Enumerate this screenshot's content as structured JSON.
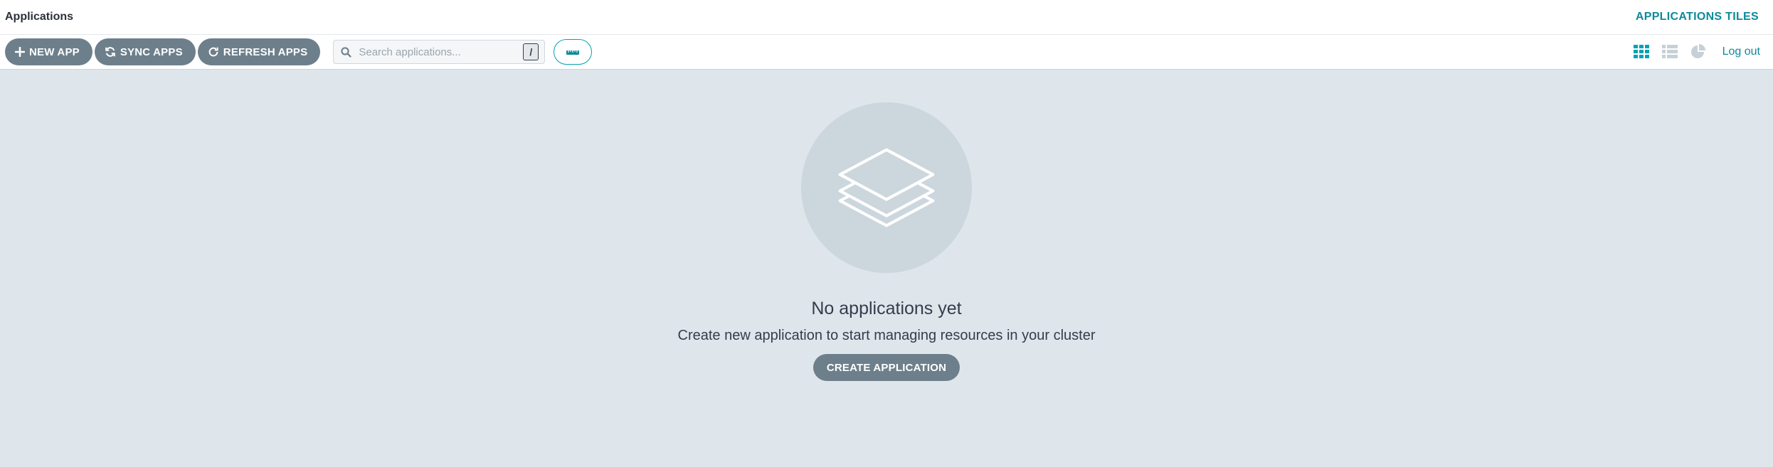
{
  "header": {
    "title": "Applications",
    "view_title": "APPLICATIONS TILES"
  },
  "toolbar": {
    "new_app_label": "NEW APP",
    "sync_apps_label": "SYNC APPS",
    "refresh_apps_label": "REFRESH APPS",
    "search_placeholder": "Search applications...",
    "search_value": "",
    "search_shortcut": "/",
    "logout_label": "Log out",
    "view_modes": [
      "tiles",
      "list",
      "summary"
    ],
    "active_view": "tiles"
  },
  "empty_state": {
    "icon": "layers-icon",
    "title": "No applications yet",
    "description": "Create new application to start managing resources in your cluster",
    "create_label": "CREATE APPLICATION"
  },
  "colors": {
    "accent": "#0c8a9a",
    "button_bg": "#6d7f8b",
    "page_bg": "#dee6ec",
    "active_icon": "#00a2b3",
    "inactive_icon": "#c7d0d6"
  }
}
